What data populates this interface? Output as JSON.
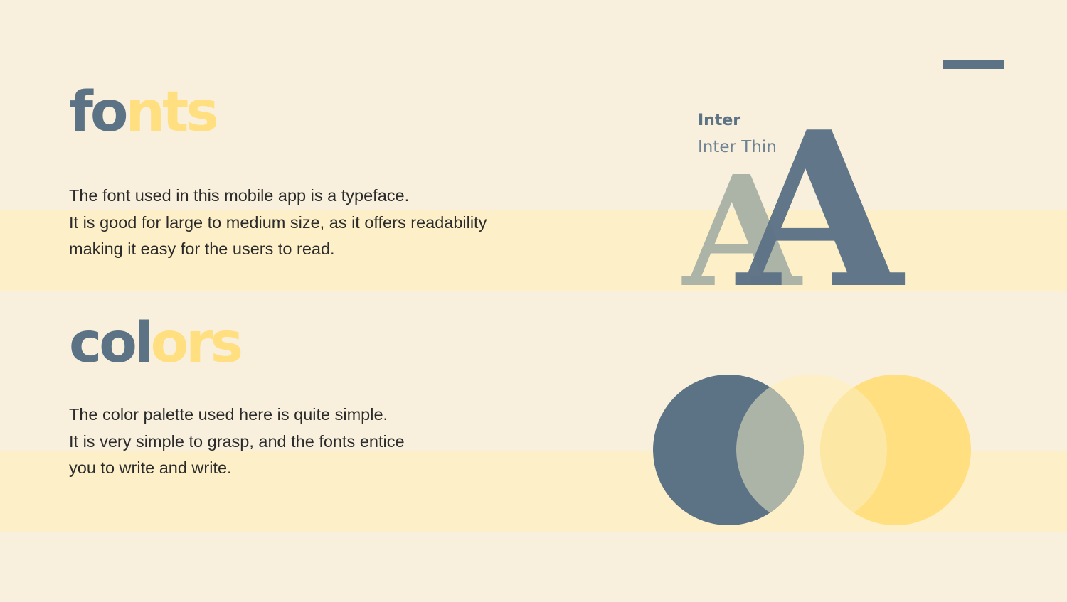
{
  "fonts_section": {
    "heading_dark": "fo",
    "heading_light": "nts",
    "lines": [
      "The font used in this mobile app is a typeface.",
      "It is good for large to medium size, as it offers readability",
      "making it easy for the users to read."
    ],
    "font_bold_name": "Inter",
    "font_thin_name": "Inter Thin",
    "sample_glyph": "A"
  },
  "colors_section": {
    "heading_dark": "col",
    "heading_light": "ors",
    "lines": [
      "The color palette used here is quite simple.",
      "It is very simple to grasp, and the fonts entice",
      "you to write and write."
    ],
    "swatches": [
      "#5c7285",
      "#fdf0c8",
      "#ffdf80"
    ]
  },
  "colors": {
    "background": "#f8f0dc",
    "band": "#fdf0c8",
    "slate": "#5c7285",
    "yellow": "#ffdf80",
    "sage": "#acb4a8"
  }
}
